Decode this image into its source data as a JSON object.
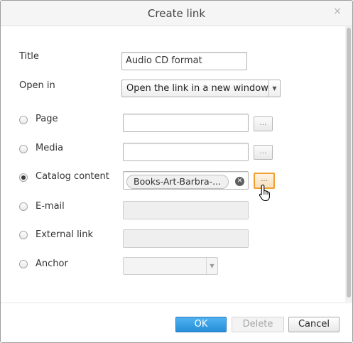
{
  "dialog": {
    "title": "Create link",
    "close_symbol": "×"
  },
  "form": {
    "title_label": "Title",
    "title_value": "Audio CD format",
    "open_in_label": "Open in",
    "open_in_value": "Open the link in a new window",
    "dropdown_arrow": "▼",
    "browse_label": "...",
    "options": {
      "page": "Page",
      "media": "Media",
      "catalog": "Catalog content",
      "email": "E-mail",
      "external": "External link",
      "anchor": "Anchor"
    },
    "selected_option": "Catalog content",
    "catalog_chip": "Books-Art-Barbra-...",
    "chip_clear_symbol": "✕"
  },
  "footer": {
    "ok_label": "OK",
    "delete_label": "Delete",
    "cancel_label": "Cancel"
  },
  "colors": {
    "primary_button": "#268fd9",
    "active_browse_border": "#f0a030"
  },
  "icons": [
    "close-icon",
    "chevron-down-icon",
    "clear-icon",
    "hand-pointer-icon"
  ]
}
